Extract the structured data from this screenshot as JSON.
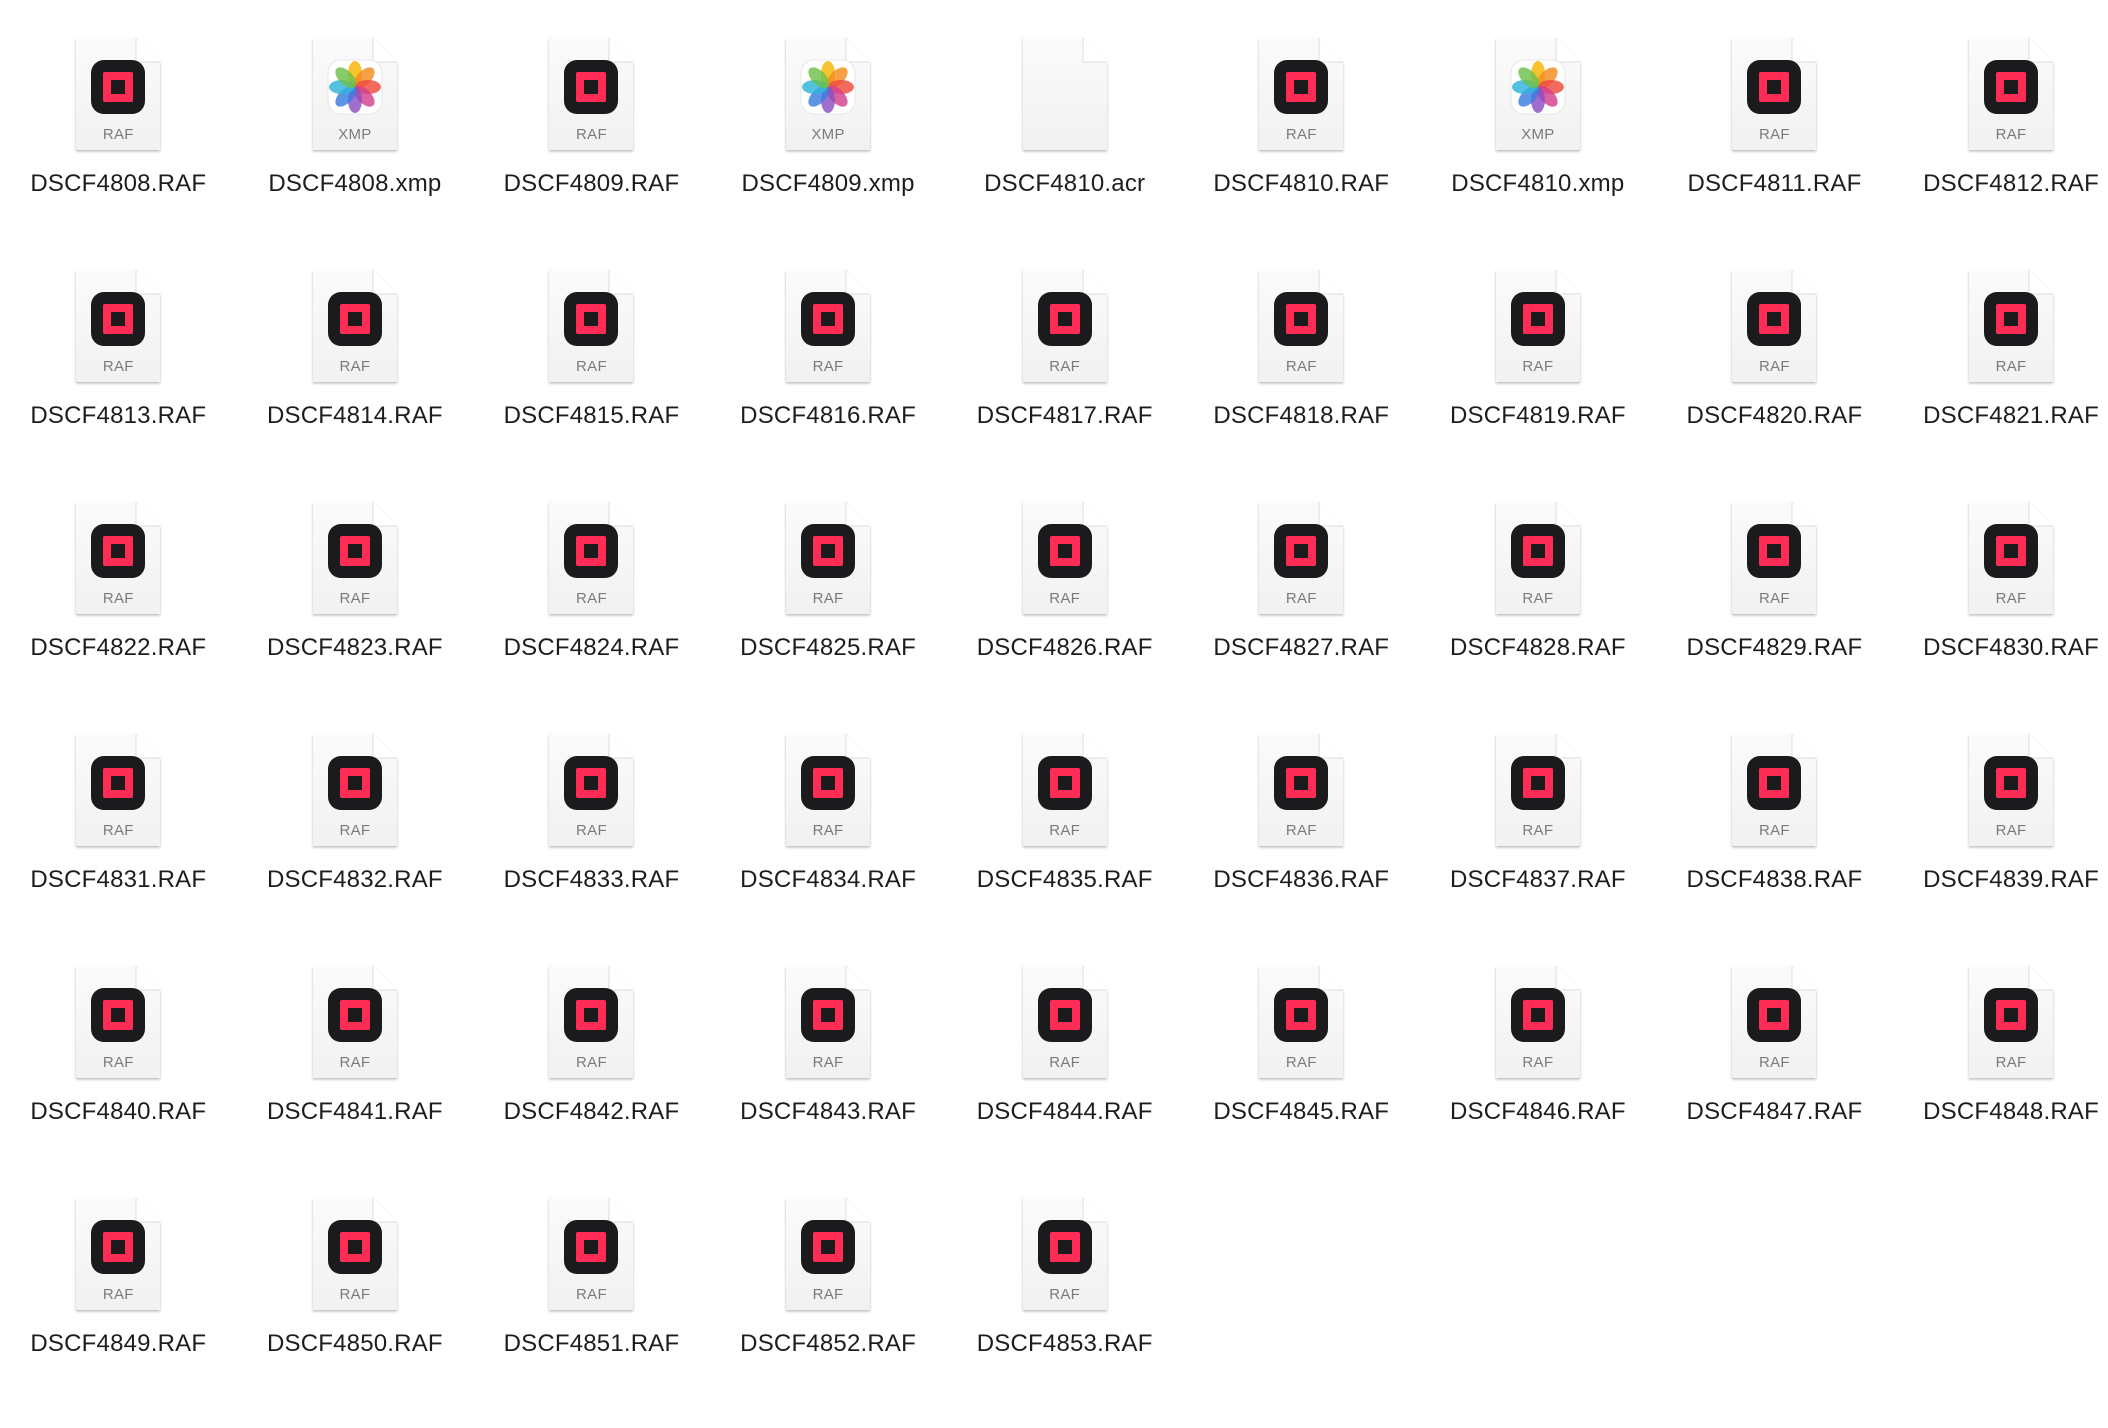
{
  "colors": {
    "raf_badge_bg": "#1b1b1d",
    "raf_badge_accent": "#ff2d55",
    "page_bg": "#ffffff",
    "label_text": "#1d1d1f",
    "ext_text": "#7b7b7b"
  },
  "icons": {
    "raf": "raf-file-icon",
    "xmp": "photos-xmp-file-icon",
    "generic": "generic-document-icon"
  },
  "files": [
    {
      "name": "DSCF4808.RAF",
      "kind": "raf",
      "ext": "RAF"
    },
    {
      "name": "DSCF4808.xmp",
      "kind": "xmp",
      "ext": "XMP"
    },
    {
      "name": "DSCF4809.RAF",
      "kind": "raf",
      "ext": "RAF"
    },
    {
      "name": "DSCF4809.xmp",
      "kind": "xmp",
      "ext": "XMP"
    },
    {
      "name": "DSCF4810.acr",
      "kind": "generic",
      "ext": ""
    },
    {
      "name": "DSCF4810.RAF",
      "kind": "raf",
      "ext": "RAF"
    },
    {
      "name": "DSCF4810.xmp",
      "kind": "xmp",
      "ext": "XMP"
    },
    {
      "name": "DSCF4811.RAF",
      "kind": "raf",
      "ext": "RAF"
    },
    {
      "name": "DSCF4812.RAF",
      "kind": "raf",
      "ext": "RAF"
    },
    {
      "name": "DSCF4813.RAF",
      "kind": "raf",
      "ext": "RAF"
    },
    {
      "name": "DSCF4814.RAF",
      "kind": "raf",
      "ext": "RAF"
    },
    {
      "name": "DSCF4815.RAF",
      "kind": "raf",
      "ext": "RAF"
    },
    {
      "name": "DSCF4816.RAF",
      "kind": "raf",
      "ext": "RAF"
    },
    {
      "name": "DSCF4817.RAF",
      "kind": "raf",
      "ext": "RAF"
    },
    {
      "name": "DSCF4818.RAF",
      "kind": "raf",
      "ext": "RAF"
    },
    {
      "name": "DSCF4819.RAF",
      "kind": "raf",
      "ext": "RAF"
    },
    {
      "name": "DSCF4820.RAF",
      "kind": "raf",
      "ext": "RAF"
    },
    {
      "name": "DSCF4821.RAF",
      "kind": "raf",
      "ext": "RAF"
    },
    {
      "name": "DSCF4822.RAF",
      "kind": "raf",
      "ext": "RAF"
    },
    {
      "name": "DSCF4823.RAF",
      "kind": "raf",
      "ext": "RAF"
    },
    {
      "name": "DSCF4824.RAF",
      "kind": "raf",
      "ext": "RAF"
    },
    {
      "name": "DSCF4825.RAF",
      "kind": "raf",
      "ext": "RAF"
    },
    {
      "name": "DSCF4826.RAF",
      "kind": "raf",
      "ext": "RAF"
    },
    {
      "name": "DSCF4827.RAF",
      "kind": "raf",
      "ext": "RAF"
    },
    {
      "name": "DSCF4828.RAF",
      "kind": "raf",
      "ext": "RAF"
    },
    {
      "name": "DSCF4829.RAF",
      "kind": "raf",
      "ext": "RAF"
    },
    {
      "name": "DSCF4830.RAF",
      "kind": "raf",
      "ext": "RAF"
    },
    {
      "name": "DSCF4831.RAF",
      "kind": "raf",
      "ext": "RAF"
    },
    {
      "name": "DSCF4832.RAF",
      "kind": "raf",
      "ext": "RAF"
    },
    {
      "name": "DSCF4833.RAF",
      "kind": "raf",
      "ext": "RAF"
    },
    {
      "name": "DSCF4834.RAF",
      "kind": "raf",
      "ext": "RAF"
    },
    {
      "name": "DSCF4835.RAF",
      "kind": "raf",
      "ext": "RAF"
    },
    {
      "name": "DSCF4836.RAF",
      "kind": "raf",
      "ext": "RAF"
    },
    {
      "name": "DSCF4837.RAF",
      "kind": "raf",
      "ext": "RAF"
    },
    {
      "name": "DSCF4838.RAF",
      "kind": "raf",
      "ext": "RAF"
    },
    {
      "name": "DSCF4839.RAF",
      "kind": "raf",
      "ext": "RAF"
    },
    {
      "name": "DSCF4840.RAF",
      "kind": "raf",
      "ext": "RAF"
    },
    {
      "name": "DSCF4841.RAF",
      "kind": "raf",
      "ext": "RAF"
    },
    {
      "name": "DSCF4842.RAF",
      "kind": "raf",
      "ext": "RAF"
    },
    {
      "name": "DSCF4843.RAF",
      "kind": "raf",
      "ext": "RAF"
    },
    {
      "name": "DSCF4844.RAF",
      "kind": "raf",
      "ext": "RAF"
    },
    {
      "name": "DSCF4845.RAF",
      "kind": "raf",
      "ext": "RAF"
    },
    {
      "name": "DSCF4846.RAF",
      "kind": "raf",
      "ext": "RAF"
    },
    {
      "name": "DSCF4847.RAF",
      "kind": "raf",
      "ext": "RAF"
    },
    {
      "name": "DSCF4848.RAF",
      "kind": "raf",
      "ext": "RAF"
    },
    {
      "name": "DSCF4849.RAF",
      "kind": "raf",
      "ext": "RAF"
    },
    {
      "name": "DSCF4850.RAF",
      "kind": "raf",
      "ext": "RAF"
    },
    {
      "name": "DSCF4851.RAF",
      "kind": "raf",
      "ext": "RAF"
    },
    {
      "name": "DSCF4852.RAF",
      "kind": "raf",
      "ext": "RAF"
    },
    {
      "name": "DSCF4853.RAF",
      "kind": "raf",
      "ext": "RAF"
    }
  ]
}
